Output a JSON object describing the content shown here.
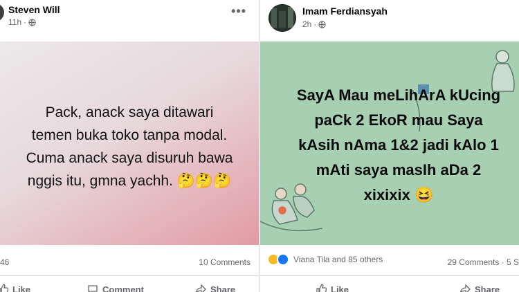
{
  "left_post": {
    "author": "Steven Will",
    "time": "11h",
    "separator": "·",
    "more_label": "•••",
    "card_lines": [
      "Pack, anack saya ditawari",
      "temen buka toko tanpa modal.",
      "Cuma anack saya disuruh bawa",
      "nggis itu, gmna yachh. 🤔🤔🤔"
    ],
    "reaction_count": "46",
    "comments": "10 Comments",
    "actions": {
      "like": "Like",
      "comment": "Comment",
      "share": "Share"
    },
    "card_colors": [
      "#ece9ea",
      "#e29ba3"
    ]
  },
  "right_post": {
    "author": "Imam Ferdiansyah",
    "time": "2h",
    "separator": "·",
    "card_lines": [
      "SayA Mau meLihArA kUcing",
      "paCk 2 EkoR mau Saya",
      "kAsih nAma 1&2 jadi kAlo 1",
      "mAti saya masIh aDa 2",
      "xixixix 😆"
    ],
    "reactions_text": "Viana Tila and 85 others",
    "comments": "29 Comments · 5 S",
    "actions": {
      "like": "Like",
      "share": "Share"
    },
    "card_color": "#a7cfb1"
  }
}
